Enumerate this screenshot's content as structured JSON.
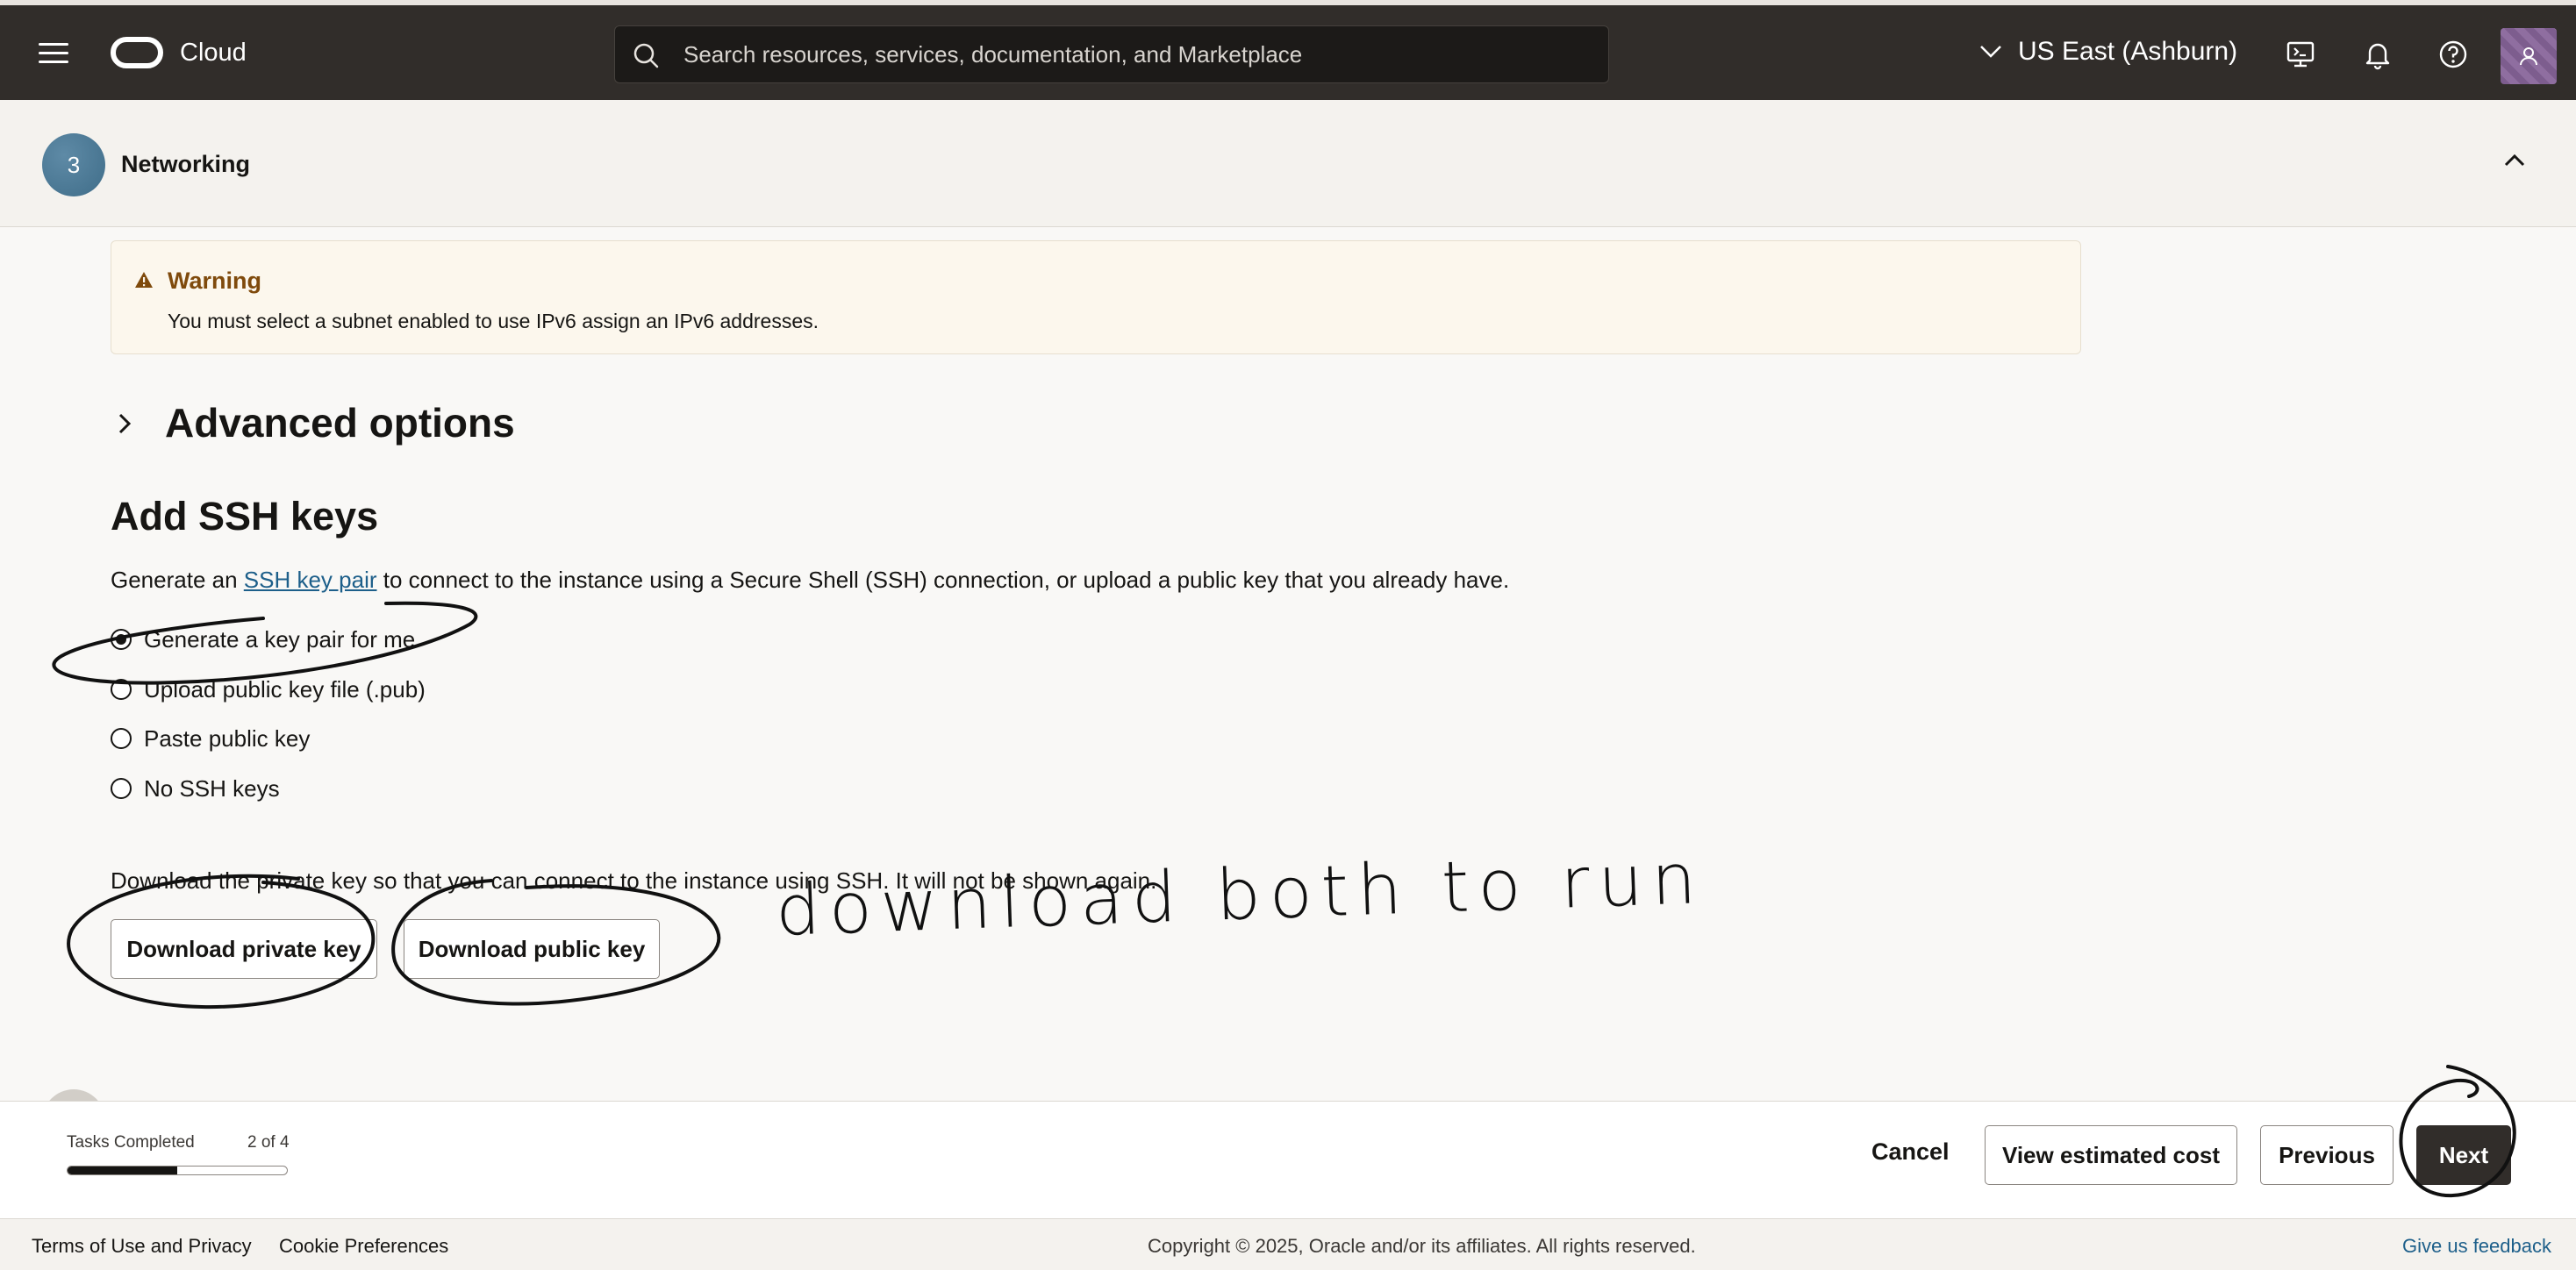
{
  "header": {
    "brand": "Cloud",
    "search_placeholder": "Search resources, services, documentation, and Marketplace",
    "region": "US East (Ashburn)"
  },
  "section": {
    "step_number": "3",
    "title": "Networking"
  },
  "warning": {
    "title": "Warning",
    "message": "You must select a subnet enabled to use IPv6 assign an IPv6 addresses."
  },
  "advanced": {
    "title": "Advanced options"
  },
  "ssh": {
    "title": "Add SSH keys",
    "desc_before": "Generate an ",
    "desc_link": "SSH key pair",
    "desc_after": " to connect to the instance using a Secure Shell (SSH) connection, or upload a public key that you already have.",
    "options": [
      {
        "label": "Generate a key pair for me",
        "checked": true
      },
      {
        "label": "Upload public key file (.pub)",
        "checked": false
      },
      {
        "label": "Paste public key",
        "checked": false
      },
      {
        "label": "No SSH keys",
        "checked": false
      }
    ],
    "download_text": "Download the private key so that you can connect to the instance using SSH. It will not be shown again.",
    "download_private_label": "Download private key",
    "download_public_label": "Download public key"
  },
  "annotation": {
    "handwritten_text": "download both to run"
  },
  "wizard": {
    "tasks_label": "Tasks Completed",
    "tasks_count": "2 of 4",
    "tasks_completed": 2,
    "tasks_total": 4,
    "cancel_label": "Cancel",
    "estimate_label": "View estimated cost",
    "previous_label": "Previous",
    "next_label": "Next"
  },
  "footer": {
    "terms": "Terms of Use and Privacy",
    "cookies": "Cookie Preferences",
    "copyright": "Copyright © 2025, Oracle and/or its affiliates. All rights reserved.",
    "feedback": "Give us feedback"
  },
  "colors": {
    "header_bg": "#312d2a",
    "link": "#1d5f8a",
    "warning_title": "#7f4a0c",
    "primary_button": "#312d2a"
  },
  "icons": [
    "hamburger-icon",
    "cloud-logo-icon",
    "search-icon",
    "chevron-down-icon",
    "cloud-shell-icon",
    "bell-icon",
    "help-icon",
    "user-icon",
    "chevron-up-icon",
    "warning-triangle-icon",
    "chevron-right-icon"
  ]
}
